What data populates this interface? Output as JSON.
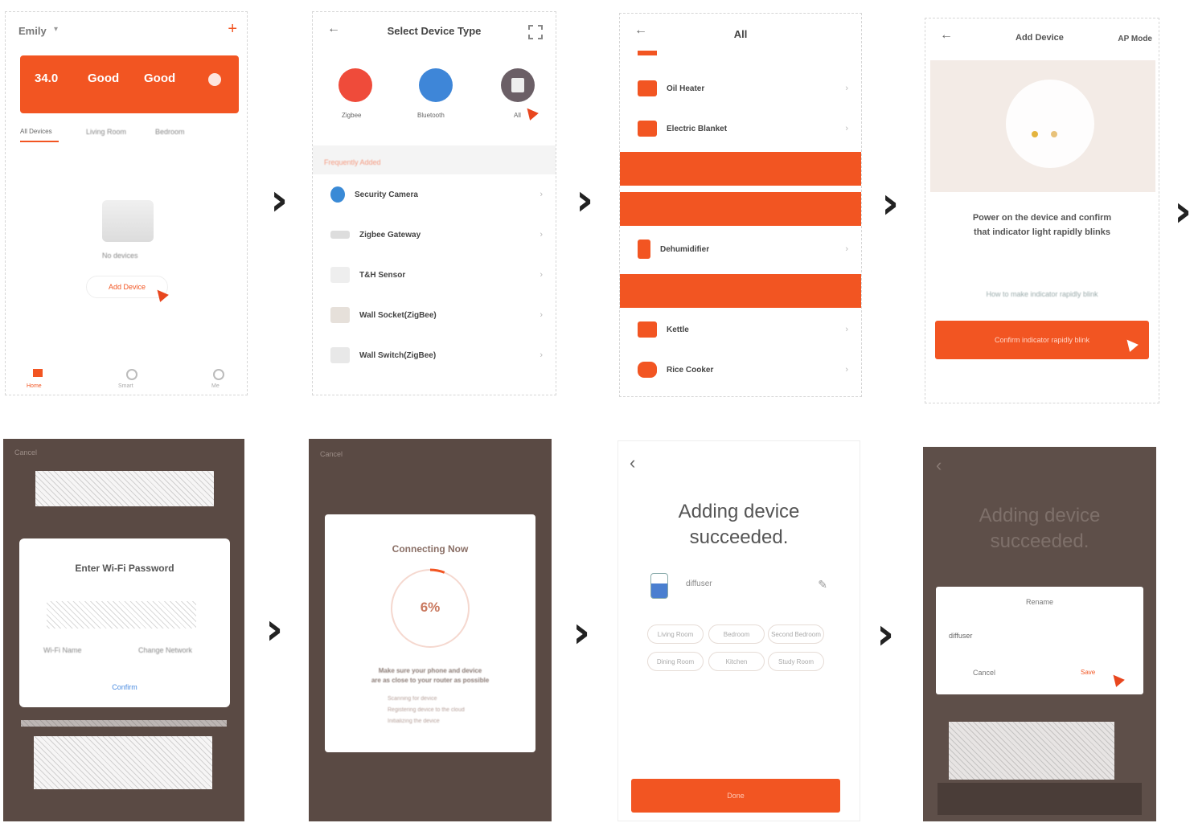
{
  "colors": {
    "accent": "#f25522",
    "dark_overlay": "#5a4a44"
  },
  "step_arrow_glyph": "›",
  "s1": {
    "user": "Emily",
    "add_icon": "plus-icon",
    "banner": {
      "temp": "34.0",
      "air": "Good",
      "humidity": "Good"
    },
    "tab_all": "All Devices",
    "tab_2": "Living Room",
    "tab_3": "Bedroom",
    "empty_text": "No devices",
    "add_device": "Add Device",
    "nav": [
      "Home",
      "Smart",
      "Me"
    ]
  },
  "s2": {
    "title": "Select Device Type",
    "types": [
      {
        "label": "Zigbee",
        "icon": "zigbee-icon"
      },
      {
        "label": "Bluetooth",
        "icon": "bluetooth-icon"
      },
      {
        "label": "All",
        "icon": "all-devices-icon"
      }
    ],
    "section": "Frequently Added",
    "items": [
      "Security Camera",
      "Zigbee Gateway",
      "T&H Sensor",
      "Wall Socket(ZigBee)",
      "Wall Switch(ZigBee)"
    ]
  },
  "s3": {
    "title": "All",
    "items": [
      "Oil Heater",
      "Electric Blanket",
      "Dehumidifier",
      "Kettle",
      "Rice Cooker"
    ]
  },
  "s4": {
    "title": "Add Device",
    "mode": "AP Mode",
    "instruction_line1": "Power on the device and confirm",
    "instruction_line2": "that indicator light rapidly blinks",
    "help_link": "How to make indicator rapidly blink",
    "confirm_button": "Confirm indicator rapidly blink"
  },
  "s5": {
    "cancel": "Cancel",
    "dialog_title": "Enter Wi-Fi Password",
    "wifi_label": "Wi-Fi Name",
    "change_network": "Change Network",
    "confirm": "Confirm"
  },
  "s6": {
    "cancel": "Cancel",
    "title": "Connecting Now",
    "progress": "6%",
    "progress_value": 6,
    "hint_line1": "Make sure your phone and device",
    "hint_line2": "are as close to your router as possible",
    "steps": [
      "Scanning for device",
      "Registering device to the cloud",
      "Initializing the device"
    ]
  },
  "s7": {
    "title_line1": "Adding device",
    "title_line2": "succeeded.",
    "device_name": "diffuser",
    "rooms": [
      "Living Room",
      "Bedroom",
      "Second Bedroom",
      "Dining Room",
      "Kitchen",
      "Study Room"
    ],
    "done_button": "Done"
  },
  "s8": {
    "title_line1": "Adding device",
    "title_line2": "succeeded.",
    "dialog_title": "Rename",
    "name": "diffuser",
    "cancel": "Cancel",
    "save": "Save"
  }
}
